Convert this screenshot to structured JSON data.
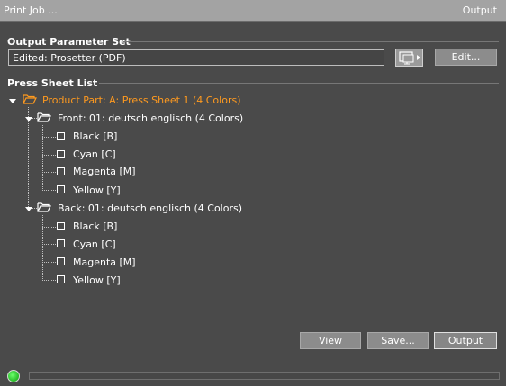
{
  "title_bar": {
    "left": "Print Job ...",
    "right": "Output"
  },
  "output_parameter_set": {
    "label": "Output Parameter Set",
    "value": "Edited: Prosetter (PDF)",
    "edit_label": "Edit..."
  },
  "press_sheet_list": {
    "label": "Press Sheet List",
    "product_part": "Product Part: A: Press Sheet 1 (4 Colors)",
    "sides": [
      {
        "label": "Front: 01: deutsch englisch (4 Colors)",
        "colors": [
          "Black  [B]",
          "Cyan  [C]",
          "Magenta  [M]",
          "Yellow  [Y]"
        ]
      },
      {
        "label": "Back: 01: deutsch englisch (4 Colors)",
        "colors": [
          "Black  [B]",
          "Cyan  [C]",
          "Magenta  [M]",
          "Yellow  [Y]"
        ]
      }
    ]
  },
  "buttons": {
    "view": "View",
    "save": "Save...",
    "output": "Output"
  },
  "colors": {
    "accent_orange": "#ff9a1f",
    "status_green": "#19c919"
  }
}
